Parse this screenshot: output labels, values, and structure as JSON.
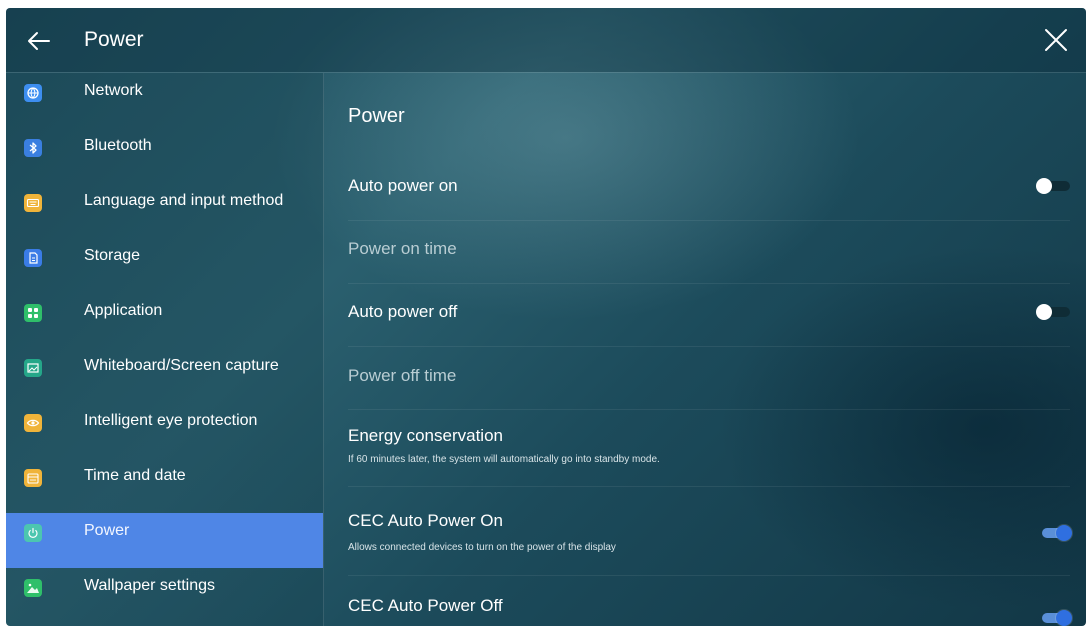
{
  "header": {
    "title": "Power"
  },
  "sidebar": {
    "items": [
      {
        "label": "Network",
        "icon": "globe-icon",
        "color": "#3d8ef0"
      },
      {
        "label": "Bluetooth",
        "icon": "bluetooth-icon",
        "color": "#3a7fe0"
      },
      {
        "label": "Language and input method",
        "icon": "keyboard-icon",
        "color": "#f0b43a"
      },
      {
        "label": "Storage",
        "icon": "storage-icon",
        "color": "#3a7ce6"
      },
      {
        "label": "Application",
        "icon": "apps-grid-icon",
        "color": "#2fbf6a"
      },
      {
        "label": "Whiteboard/Screen capture",
        "icon": "screen-capture-icon",
        "color": "#25a789"
      },
      {
        "label": "Intelligent eye protection",
        "icon": "eye-icon",
        "color": "#f0b43a"
      },
      {
        "label": "Time and date",
        "icon": "calendar-icon",
        "color": "#f0b43a"
      },
      {
        "label": "Power",
        "icon": "power-icon",
        "color": "#4cc6b0",
        "active": true
      },
      {
        "label": "Wallpaper settings",
        "icon": "image-icon",
        "color": "#2fbf6a"
      }
    ]
  },
  "main": {
    "title": "Power",
    "rows": [
      {
        "label": "Auto power on",
        "toggle": "off"
      },
      {
        "label": "Power on time"
      },
      {
        "label": "Auto power off",
        "toggle": "off"
      },
      {
        "label": "Power off time"
      },
      {
        "label": "Energy conservation",
        "subtitle": "If 60 minutes later, the system will automatically go into standby mode."
      },
      {
        "label": "CEC Auto Power On",
        "subtitle": "Allows connected devices to turn on the power of the display",
        "toggle": "on"
      },
      {
        "label": "CEC Auto Power Off",
        "toggle": "on"
      }
    ]
  }
}
